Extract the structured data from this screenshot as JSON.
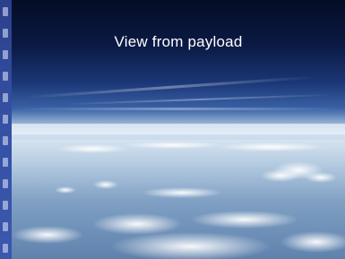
{
  "caption": "View from payload",
  "colors": {
    "space_top": "#050c24",
    "sky_mid": "#1f3f86",
    "horizon_haze": "#cfe0f0",
    "cloud_white": "#f4f8fc",
    "side_strip": "#3550a3"
  }
}
